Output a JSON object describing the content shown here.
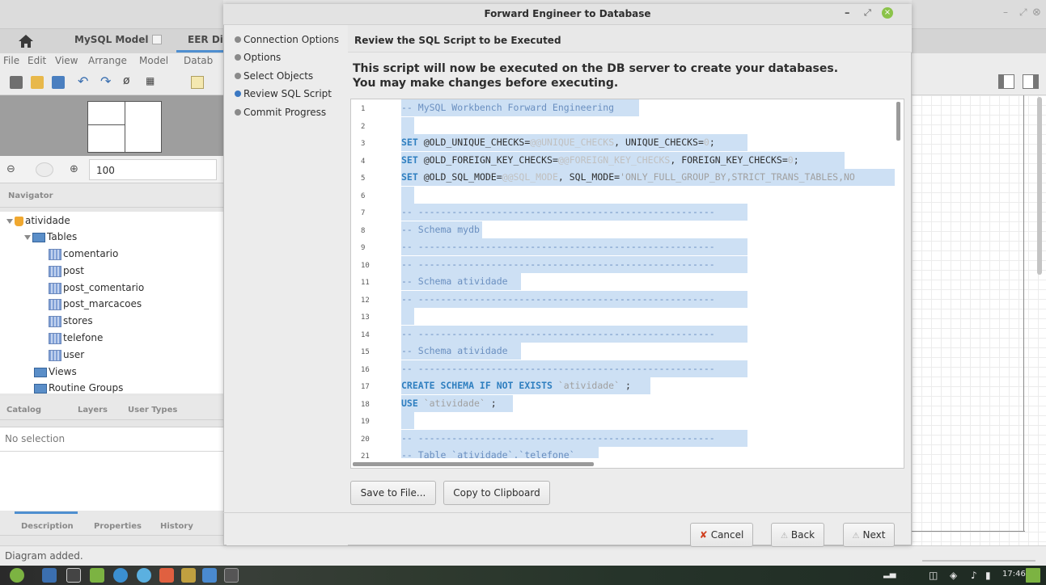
{
  "left_window": {
    "tabs": [
      "MySQL Model",
      "EER Dia"
    ],
    "menu": [
      "File",
      "Edit",
      "View",
      "Arrange",
      "Model",
      "Datab"
    ],
    "zoom_value": "100",
    "navigator_label": "Navigator",
    "tree": {
      "schema": "atividade",
      "tables_label": "Tables",
      "tables": [
        "comentario",
        "post",
        "post_comentario",
        "post_marcacoes",
        "stores",
        "telefone",
        "user"
      ],
      "views_label": "Views",
      "routines_label": "Routine Groups"
    },
    "catalog_tabs": [
      "Catalog",
      "Layers",
      "User Types"
    ],
    "no_selection": "No selection",
    "bottom_tabs": [
      "Description",
      "Properties",
      "History"
    ],
    "status": "Diagram added."
  },
  "dialog": {
    "title": "Forward Engineer to Database",
    "steps": [
      {
        "label": "Connection Options",
        "active": false
      },
      {
        "label": "Options",
        "active": false
      },
      {
        "label": "Select Objects",
        "active": false
      },
      {
        "label": "Review SQL Script",
        "active": true
      },
      {
        "label": "Commit Progress",
        "active": false
      }
    ],
    "subtitle": "Review the SQL Script to be Executed",
    "instruction_line1": "This script will now be executed on the DB server to create your databases.",
    "instruction_line2": "You may make changes before executing.",
    "line_numbers": [
      "1",
      "2",
      "3",
      "4",
      "5",
      "6",
      "7",
      "8",
      "9",
      "10",
      "11",
      "12",
      "13",
      "14",
      "15",
      "16",
      "17",
      "18",
      "19",
      "20",
      "21"
    ],
    "code": {
      "l1": "-- MySQL Workbench Forward Engineering",
      "l3a": "SET",
      "l3b": " @OLD_UNIQUE_CHECKS=",
      "l3c": "@@UNIQUE_CHECKS",
      "l3d": ", UNIQUE_CHECKS=",
      "l3e": "0",
      "l3f": ";",
      "l4a": "SET",
      "l4b": " @OLD_FOREIGN_KEY_CHECKS=",
      "l4c": "@@FOREIGN_KEY_CHECKS",
      "l4d": ", FOREIGN_KEY_CHECKS=",
      "l4e": "0",
      "l4f": ";",
      "l5a": "SET",
      "l5b": " @OLD_SQL_MODE=",
      "l5c": "@@SQL_MODE",
      "l5d": ", SQL_MODE=",
      "l5e": "'ONLY_FULL_GROUP_BY,STRICT_TRANS_TABLES,NO",
      "rule": "-- -----------------------------------------------------",
      "l8": "-- Schema mydb",
      "l11": "-- Schema atividade",
      "l15": "-- Schema atividade",
      "l17a": "CREATE SCHEMA IF NOT EXISTS",
      "l17b": " `atividade`",
      "l17c": " ;",
      "l18a": "USE",
      "l18b": " `atividade`",
      "l18c": " ;",
      "l21": "-- Table `atividade`.`telefone`"
    },
    "buttons": {
      "save": "Save to File...",
      "copy": "Copy to Clipboard",
      "cancel": "Cancel",
      "back": "Back",
      "next": "Next"
    }
  },
  "taskbar": {
    "clock": "17:46"
  },
  "colors": {
    "selection": "#cde0f4",
    "keyword": "#2f7fc0",
    "active_step": "#3b78c2",
    "close_button": "#8bc34a"
  }
}
